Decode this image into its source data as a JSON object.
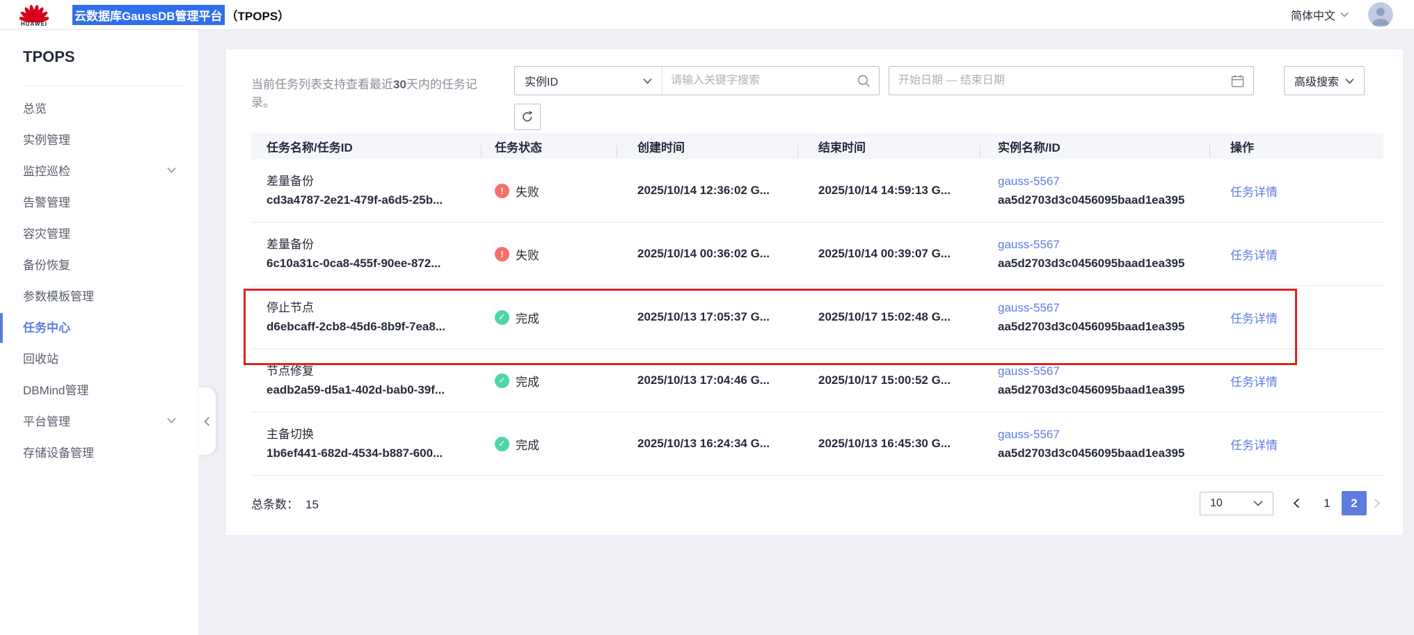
{
  "topbar": {
    "brand": "HUAWEI",
    "title_highlighted": "云数据库GaussDB管理平台",
    "title_paren": "（TPOPS）",
    "language": "简体中文"
  },
  "sidebar": {
    "title": "TPOPS",
    "items": [
      {
        "label": "总览",
        "expandable": false,
        "active": false
      },
      {
        "label": "实例管理",
        "expandable": false,
        "active": false
      },
      {
        "label": "监控巡检",
        "expandable": true,
        "active": false
      },
      {
        "label": "告警管理",
        "expandable": false,
        "active": false
      },
      {
        "label": "容灾管理",
        "expandable": false,
        "active": false
      },
      {
        "label": "备份恢复",
        "expandable": false,
        "active": false
      },
      {
        "label": "参数模板管理",
        "expandable": false,
        "active": false
      },
      {
        "label": "任务中心",
        "expandable": false,
        "active": true
      },
      {
        "label": "回收站",
        "expandable": false,
        "active": false
      },
      {
        "label": "DBMind管理",
        "expandable": false,
        "active": false
      },
      {
        "label": "平台管理",
        "expandable": true,
        "active": false
      },
      {
        "label": "存储设备管理",
        "expandable": false,
        "active": false
      }
    ]
  },
  "toolbar": {
    "info_before": "当前任务列表支持查看最近",
    "info_bold": "30",
    "info_after": "天内的任务记录。",
    "filter_selected": "实例ID",
    "keyword_placeholder": "请输入关键字搜索",
    "date_placeholder": "开始日期 — 结束日期",
    "advanced_search": "高级搜索"
  },
  "table": {
    "columns": [
      "任务名称/任务ID",
      "任务状态",
      "创建时间",
      "结束时间",
      "实例名称/ID",
      "操作"
    ],
    "rows": [
      {
        "name": "差量备份",
        "id": "cd3a4787-2e21-479f-a6d5-25b...",
        "status": "失败",
        "status_type": "fail",
        "created": "2025/10/14 12:36:02 G...",
        "ended": "2025/10/14 14:59:13 G...",
        "instance_name": "gauss-5567",
        "instance_id": "aa5d2703d3c0456095baad1ea395",
        "action": "任务详情",
        "highlighted": false
      },
      {
        "name": "差量备份",
        "id": "6c10a31c-0ca8-455f-90ee-872...",
        "status": "失败",
        "status_type": "fail",
        "created": "2025/10/14 00:36:02 G...",
        "ended": "2025/10/14 00:39:07 G...",
        "instance_name": "gauss-5567",
        "instance_id": "aa5d2703d3c0456095baad1ea395",
        "action": "任务详情",
        "highlighted": false
      },
      {
        "name": "停止节点",
        "id": "d6ebcaff-2cb8-45d6-8b9f-7ea8...",
        "status": "完成",
        "status_type": "done",
        "created": "2025/10/13 17:05:37 G...",
        "ended": "2025/10/17 15:02:48 G...",
        "instance_name": "gauss-5567",
        "instance_id": "aa5d2703d3c0456095baad1ea395",
        "action": "任务详情",
        "highlighted": true
      },
      {
        "name": "节点修复",
        "id": "eadb2a59-d5a1-402d-bab0-39f...",
        "status": "完成",
        "status_type": "done",
        "created": "2025/10/13 17:04:46 G...",
        "ended": "2025/10/17 15:00:52 G...",
        "instance_name": "gauss-5567",
        "instance_id": "aa5d2703d3c0456095baad1ea395",
        "action": "任务详情",
        "highlighted": false
      },
      {
        "name": "主备切换",
        "id": "1b6ef441-682d-4534-b887-600...",
        "status": "完成",
        "status_type": "done",
        "created": "2025/10/13 16:24:34 G...",
        "ended": "2025/10/13 16:45:30 G...",
        "instance_name": "gauss-5567",
        "instance_id": "aa5d2703d3c0456095baad1ea395",
        "action": "任务详情",
        "highlighted": false
      }
    ]
  },
  "pagination": {
    "total_label": "总条数：",
    "total": "15",
    "page_size": "10",
    "pages": [
      "1",
      "2"
    ],
    "active_page": "2"
  },
  "annotation": {
    "type": "red-highlight-rectangle",
    "target_row": 3,
    "color": "#e02121"
  },
  "colors": {
    "accent_blue": "#5e7ce0",
    "selection_blue": "#2f6fed",
    "fail_red": "#f66f6a",
    "success_green": "#50d4ab",
    "background_gray": "#eef0f5",
    "text_dark": "#252b3a",
    "text_gray": "#8a8e99"
  }
}
